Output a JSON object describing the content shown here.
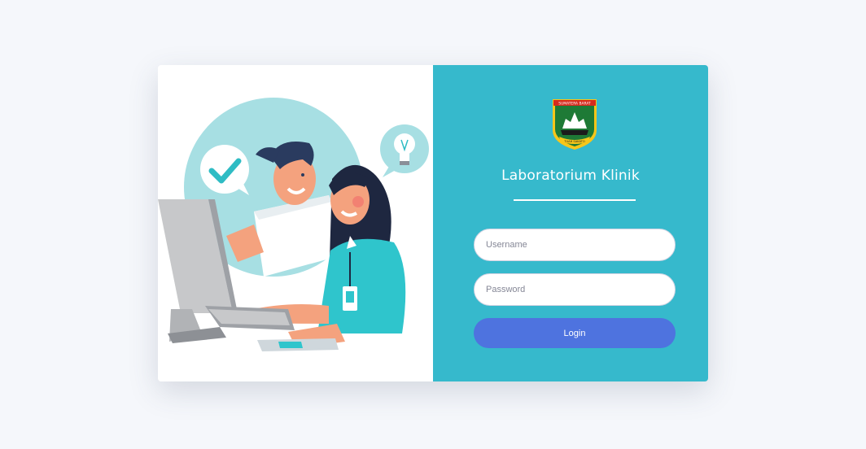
{
  "logo": {
    "top_text": "SUMATERA BARAT",
    "bottom_text": "TUAH SAKATO"
  },
  "app": {
    "title": "Laboratorium Klinik"
  },
  "form": {
    "username_placeholder": "Username",
    "password_placeholder": "Password",
    "login_label": "Login"
  },
  "colors": {
    "panel": "#36b9cc",
    "button": "#4e73df",
    "background": "#f5f7fb"
  }
}
